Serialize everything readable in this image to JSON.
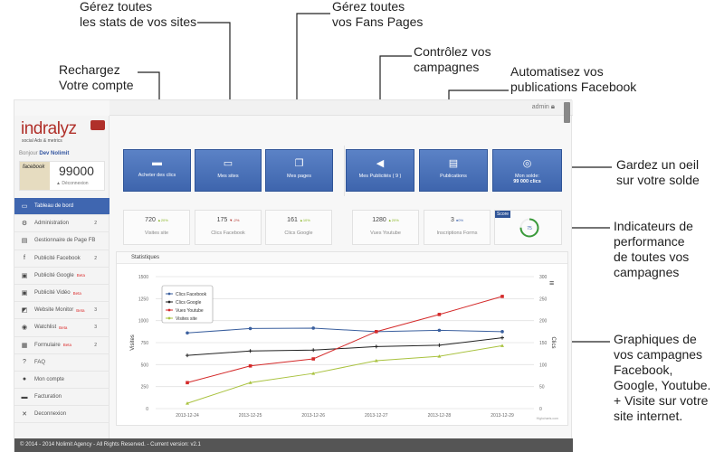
{
  "annotations": {
    "stats_sites": [
      "Gérez toutes",
      "les stats de vos sites"
    ],
    "fans_pages": [
      "Gérez toutes",
      "vos Fans Pages"
    ],
    "recharge": [
      "Rechargez",
      "Votre compte"
    ],
    "campagnes": [
      "Contrôlez vos",
      "campagnes"
    ],
    "publications": [
      "Automatisez vos",
      "publications Facebook"
    ],
    "solde": [
      "Gardez un oeil",
      "sur votre solde"
    ],
    "indicateurs": [
      "Indicateurs de",
      "performance",
      "de toutes vos",
      "campagnes"
    ],
    "graphiques": [
      "Graphiques de",
      "vos campagnes",
      "Facebook,",
      "Google, Youtube.",
      "+ Visite sur votre",
      "site internet."
    ]
  },
  "topbar": {
    "user": "admin"
  },
  "sidebar": {
    "logo": "indralyz",
    "tagline": "social Ads & metrics",
    "greeting": "Bonjour",
    "user": "Dev Nolimit",
    "photo_text": "facebook",
    "balance": "99000",
    "logout": "Déconnexion",
    "items": [
      {
        "label": "Tableau de bord",
        "icon": "monitor-icon",
        "glyph": "▭",
        "active": true
      },
      {
        "label": "Administration",
        "icon": "gears-icon",
        "glyph": "⚙",
        "count": "2"
      },
      {
        "label": "Gestionnaire de Page FB",
        "icon": "pages-icon",
        "glyph": "▤"
      },
      {
        "label": "Publicité Facebook",
        "icon": "facebook-icon",
        "glyph": "f",
        "count": "2"
      },
      {
        "label": "Publicité Google",
        "icon": "google-ads-icon",
        "glyph": "▣",
        "beta": "Beta"
      },
      {
        "label": "Publicité Vidéo",
        "icon": "video-icon",
        "glyph": "▣",
        "beta": "Beta"
      },
      {
        "label": "Website Monitor",
        "icon": "chart-icon",
        "glyph": "◩",
        "beta": "Beta",
        "count": "3"
      },
      {
        "label": "Watchlist",
        "icon": "eye-icon",
        "glyph": "◉",
        "beta": "Beta",
        "count": "3"
      },
      {
        "label": "Formulaire",
        "icon": "form-icon",
        "glyph": "▦",
        "beta": "Beta",
        "count": "2"
      },
      {
        "label": "FAQ",
        "icon": "question-icon",
        "glyph": "?"
      },
      {
        "label": "Mon compte",
        "icon": "user-icon",
        "glyph": "●"
      },
      {
        "label": "Facturation",
        "icon": "invoice-icon",
        "glyph": "▬"
      },
      {
        "label": "Deconnexion",
        "icon": "close-icon",
        "glyph": "✕"
      }
    ]
  },
  "buttons": [
    {
      "label": "Acheter des clics",
      "icon": "credit-card-icon",
      "glyph": "▬"
    },
    {
      "label": "Mes sites",
      "icon": "monitor-icon",
      "glyph": "▭"
    },
    {
      "label": "Mes pages",
      "icon": "pages-icon",
      "glyph": "❐"
    },
    {
      "label": "Mes Publicités ( 9 )",
      "icon": "megaphone-icon",
      "glyph": "◀"
    },
    {
      "label": "Publications",
      "icon": "document-share-icon",
      "glyph": "▤"
    },
    {
      "label": "Mon solde:",
      "sub": "99 000 clics",
      "icon": "coins-icon",
      "glyph": "◎"
    }
  ],
  "stat_boxes": [
    {
      "value": "720",
      "delta": "▲20%",
      "dir": "up",
      "label": "Visites site"
    },
    {
      "value": "175",
      "delta": "▼-2%",
      "dir": "down",
      "label": "Clics Facebook"
    },
    {
      "value": "161",
      "delta": "▲10%",
      "dir": "up",
      "label": "Clics Google"
    },
    {
      "value": "1280",
      "delta": "▲20%",
      "dir": "up",
      "label": "Vues Youtube"
    },
    {
      "value": "3",
      "delta": "●0%",
      "dir": "flat",
      "label": "Inscriptions Forms"
    }
  ],
  "score": {
    "label": "Score",
    "value": "75",
    "percent": 75
  },
  "stats_panel": {
    "title": "Statistiques"
  },
  "footer": "© 2014 - 2014 Nolimit Agency - All Rights Reserved. - Current version: v2.1",
  "colors": {
    "accent": "#3f66b0",
    "up": "#8cb82b",
    "down": "#b0302a"
  },
  "chart_data": {
    "type": "line",
    "x": [
      "2013-12-24",
      "2013-12-25",
      "2013-12-26",
      "2013-12-27",
      "2013-12-28",
      "2013-12-29"
    ],
    "ylabel": "Visites",
    "y2label": "Clics",
    "ylim": [
      0,
      1500
    ],
    "y2lim": [
      0,
      300
    ],
    "yticks": [
      0,
      250,
      500,
      750,
      1000,
      1250,
      1500
    ],
    "y2ticks": [
      0,
      50,
      100,
      150,
      200,
      250,
      300
    ],
    "grid": true,
    "legend": "top-left",
    "credit": "Highcharts.com",
    "series": [
      {
        "name": "Clics Facebook",
        "axis": "right",
        "color": "#3a5f9e",
        "marker": "circle",
        "values": [
          172,
          182,
          183,
          175,
          178,
          175
        ]
      },
      {
        "name": "Clics Google",
        "axis": "right",
        "color": "#222222",
        "marker": "cross",
        "values": [
          121,
          131,
          133,
          141,
          144,
          161
        ]
      },
      {
        "name": "Vues Youtube",
        "axis": "left",
        "color": "#d42a2a",
        "marker": "square",
        "values": [
          295,
          485,
          565,
          875,
          1070,
          1275
        ]
      },
      {
        "name": "Visites site",
        "axis": "left",
        "color": "#a9c23f",
        "marker": "triangle",
        "values": [
          60,
          295,
          400,
          545,
          595,
          715
        ]
      }
    ]
  }
}
